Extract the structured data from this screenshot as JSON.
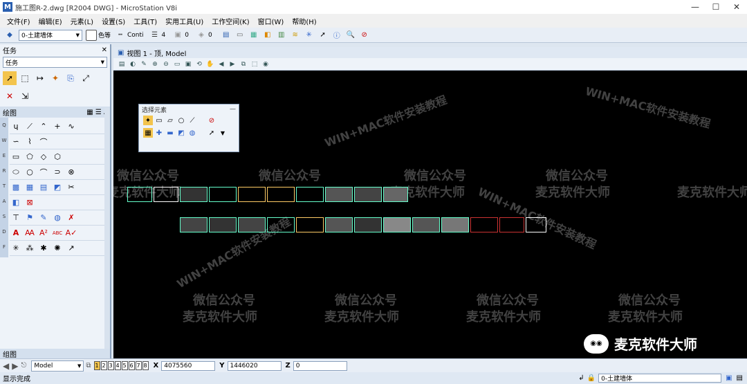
{
  "window": {
    "title": "施工图R-2.dwg [R2004 DWG] - MicroStation V8i",
    "minimize": "—",
    "maximize": "☐",
    "close": "✕"
  },
  "menu": [
    "文件(F)",
    "编辑(E)",
    "元素(L)",
    "设置(S)",
    "工具(T)",
    "实用工具(U)",
    "工作空间(K)",
    "窗口(W)",
    "帮助(H)"
  ],
  "toolbar": {
    "level_combo": "0-土建墙体",
    "color_label": "色等",
    "linestyle_label": "Conti",
    "weight_value": "4",
    "transparency_value": "0",
    "priority_value": "0"
  },
  "left_panel": {
    "header": "任务",
    "task_select": "任务",
    "section_title": "绘图",
    "side_letters": [
      "Q",
      "W",
      "E",
      "R",
      "T",
      "A",
      "S",
      "D",
      "F"
    ],
    "footer": "组图"
  },
  "view": {
    "title": "视图 1 - 顶, Model"
  },
  "floating_toolbox": {
    "title": "选择元素",
    "close": "—"
  },
  "watermark": {
    "line1": "微信公众号",
    "line2": "麦克软件大师",
    "ring": "WIN+MAC软件安装教程",
    "brand": "麦克软件大师"
  },
  "bottom_bar": {
    "model_select": "Model",
    "pages": [
      "1",
      "2",
      "3",
      "4",
      "5",
      "6",
      "7",
      "8"
    ],
    "x_label": "X",
    "x_value": "4075560",
    "y_label": "Y",
    "y_value": "1446020",
    "z_label": "Z",
    "z_value": "0"
  },
  "status_bar": {
    "message": "显示完成",
    "level": "0-土建墙体"
  }
}
